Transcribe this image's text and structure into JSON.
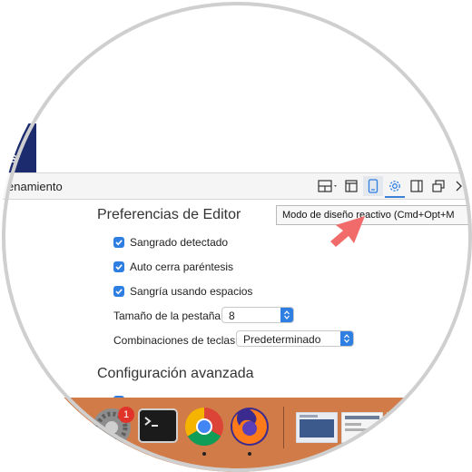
{
  "brand": {
    "partial_text": "s",
    "color": "#1c2a6e"
  },
  "toolbar": {
    "title_partial": "enamiento",
    "buttons": [
      {
        "name": "split-layout-icon"
      },
      {
        "name": "panel-left-icon"
      },
      {
        "name": "responsive-mode-icon",
        "active": true
      },
      {
        "name": "gear-icon",
        "selected": true
      },
      {
        "name": "sidebar-icon"
      },
      {
        "name": "windows-icon"
      },
      {
        "name": "chevron-right-icon"
      }
    ],
    "tooltip": "Modo de diseño reactivo (Cmd+Opt+M"
  },
  "editor_prefs": {
    "title": "Preferencias de Editor",
    "checkboxes": [
      {
        "label": "Sangrado detectado",
        "checked": true
      },
      {
        "label": "Auto cerra paréntesis",
        "checked": true
      },
      {
        "label": "Sangría usando espacios",
        "checked": true
      }
    ],
    "tab_size": {
      "label": "Tamaño de la pestaña",
      "value": "8"
    },
    "keybindings": {
      "label": "Combinaciones de teclas",
      "value": "Predeterminado"
    }
  },
  "advanced": {
    "title": "Configuración avanzada"
  },
  "dock": {
    "apps": [
      {
        "name": "system-preferences-icon",
        "badge": "1"
      },
      {
        "name": "terminal-icon"
      },
      {
        "name": "chrome-icon",
        "running": true
      },
      {
        "name": "firefox-icon",
        "running": true
      },
      {
        "name": "window-thumbnail-1"
      },
      {
        "name": "window-thumbnail-2"
      }
    ]
  },
  "colors": {
    "accent": "#2f7fe3",
    "dock": "#d07b48",
    "annotation_arrow": "#f26b6b"
  }
}
